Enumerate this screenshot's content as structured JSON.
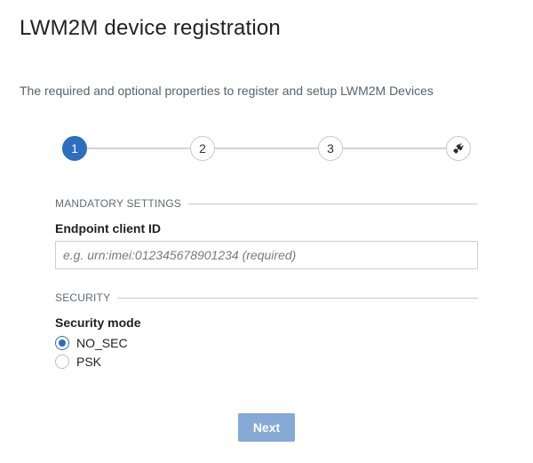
{
  "page": {
    "title": "LWM2M device registration",
    "subtitle": "The required and optional properties to register and setup LWM2M Devices"
  },
  "stepper": {
    "steps": [
      {
        "label": "1",
        "active": true
      },
      {
        "label": "2",
        "active": false
      },
      {
        "label": "3",
        "active": false
      },
      {
        "label": "",
        "icon": "plug-icon",
        "active": false
      }
    ]
  },
  "mandatory": {
    "header": "MANDATORY SETTINGS",
    "endpoint_label": "Endpoint client ID",
    "endpoint_placeholder": "e.g. urn:imei:012345678901234 (required)",
    "endpoint_value": ""
  },
  "security": {
    "header": "SECURITY",
    "mode_label": "Security mode",
    "options": [
      {
        "label": "NO_SEC",
        "checked": true
      },
      {
        "label": "PSK",
        "checked": false
      }
    ]
  },
  "actions": {
    "next_label": "Next"
  },
  "colors": {
    "accent": "#2d6ebe",
    "button_disabled": "#86a9d6"
  }
}
